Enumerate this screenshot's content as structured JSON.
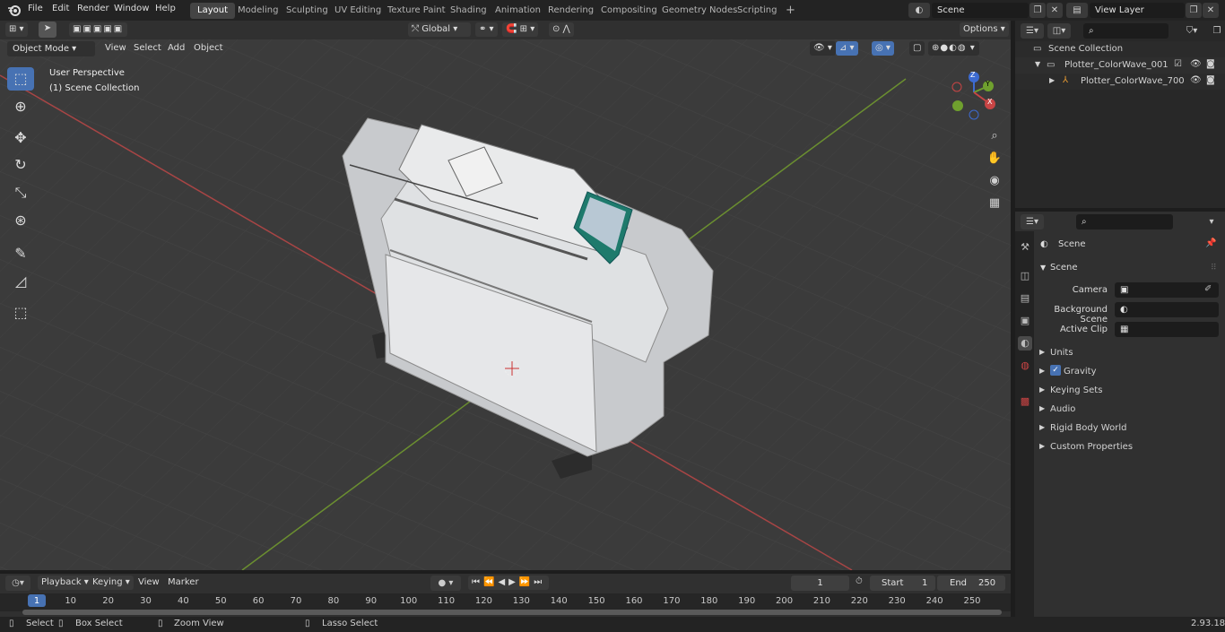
{
  "app": {
    "logo": "blender-logo-icon",
    "version": "2.93.18"
  },
  "menus": [
    "File",
    "Edit",
    "Render",
    "Window",
    "Help"
  ],
  "workspaces": [
    "Layout",
    "Modeling",
    "Sculpting",
    "UV Editing",
    "Texture Paint",
    "Shading",
    "Animation",
    "Rendering",
    "Compositing",
    "Geometry Nodes",
    "Scripting"
  ],
  "active_workspace": "Layout",
  "scene_field": "Scene",
  "view_layer_field": "View Layer",
  "viewport": {
    "mode": "Object Mode",
    "menu": [
      "View",
      "Select",
      "Add",
      "Object"
    ],
    "transform_orientation": "Global",
    "options": "Options",
    "overlay_title": "User Perspective",
    "overlay_sub": "(1) Scene Collection",
    "gizmo": {
      "x": "X",
      "y": "Y",
      "z": "Z"
    }
  },
  "outliner": {
    "root": "Scene Collection",
    "items": [
      {
        "label": "Plotter_ColorWave_001"
      },
      {
        "label": "Plotter_ColorWave_700"
      }
    ]
  },
  "properties": {
    "context": "Scene",
    "section": "Scene",
    "fields": [
      {
        "label": "Camera",
        "value": ""
      },
      {
        "label": "Background Scene",
        "value": ""
      },
      {
        "label": "Active Clip",
        "value": ""
      }
    ],
    "panels": [
      "Units",
      "Gravity",
      "Keying Sets",
      "Audio",
      "Rigid Body World",
      "Custom Properties"
    ],
    "gravity_checked": true
  },
  "timeline": {
    "menus": [
      "Playback",
      "Keying",
      "View",
      "Marker"
    ],
    "current_frame": "1",
    "start_label": "Start",
    "start": "1",
    "end_label": "End",
    "end": "250",
    "ruler": [
      "1",
      "10",
      "20",
      "30",
      "40",
      "50",
      "60",
      "70",
      "80",
      "90",
      "100",
      "110",
      "120",
      "130",
      "140",
      "150",
      "160",
      "170",
      "180",
      "190",
      "200",
      "210",
      "220",
      "230",
      "240",
      "250"
    ]
  },
  "status": {
    "select": "Select",
    "box_select": "Box Select",
    "zoom_view": "Zoom View",
    "lasso_select": "Lasso Select"
  },
  "colors": {
    "accent": "#4772b3",
    "x_axis": "#c24a4a",
    "y_axis": "#7ba13a"
  }
}
